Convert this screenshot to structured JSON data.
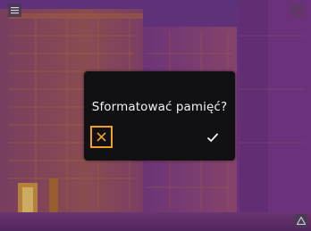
{
  "dialog": {
    "title": "Sformatować pamięć?",
    "cancel_icon": "close-icon",
    "confirm_icon": "checkmark-icon"
  },
  "icons": {
    "top_left": "menu-icon",
    "top_right": "overlay-toggle-icon",
    "bottom_right": "warning-icon"
  },
  "colors": {
    "accent": "#f0a020",
    "dialog_bg": "#111114",
    "dialog_text": "#f2f2f2",
    "thermal_cold": "#5a2a80",
    "thermal_warm": "#c87a2a"
  }
}
